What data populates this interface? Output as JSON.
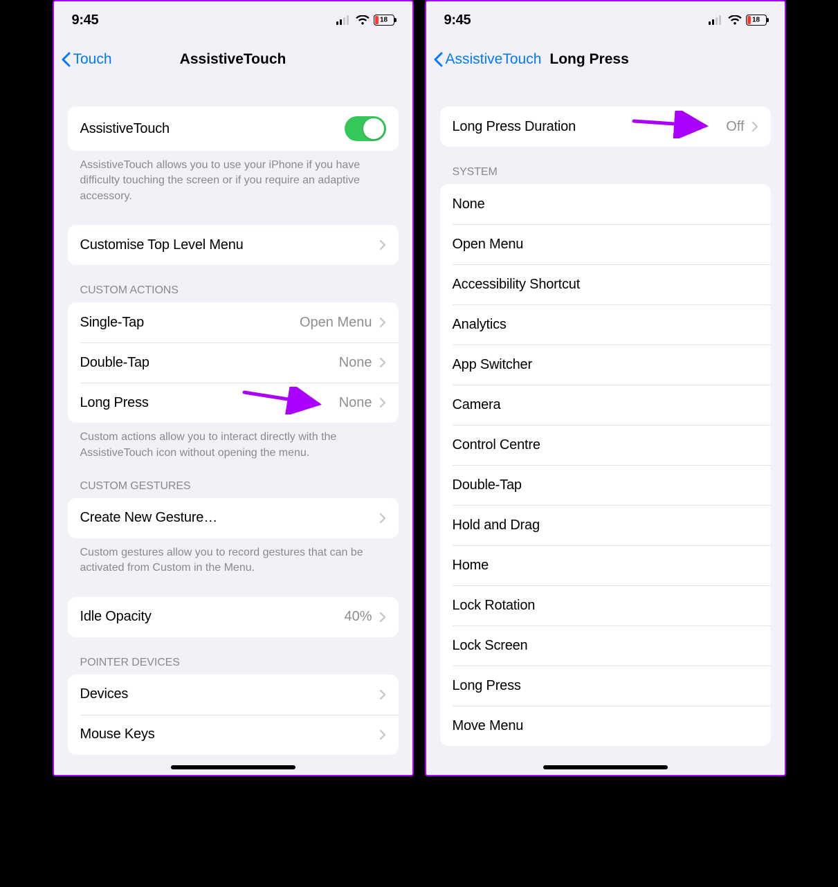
{
  "statusBar": {
    "time": "9:45",
    "batteryPercent": "18"
  },
  "left": {
    "back": "Touch",
    "title": "AssistiveTouch",
    "toggle": {
      "label": "AssistiveTouch"
    },
    "toggleFooter": "AssistiveTouch allows you to use your iPhone if you have difficulty touching the screen or if you require an adaptive accessory.",
    "customise": {
      "label": "Customise Top Level Menu"
    },
    "customActionsHeader": "CUSTOM ACTIONS",
    "customActions": [
      {
        "label": "Single-Tap",
        "value": "Open Menu"
      },
      {
        "label": "Double-Tap",
        "value": "None"
      },
      {
        "label": "Long Press",
        "value": "None"
      }
    ],
    "customActionsFooter": "Custom actions allow you to interact directly with the AssistiveTouch icon without opening the menu.",
    "customGesturesHeader": "CUSTOM GESTURES",
    "createGesture": {
      "label": "Create New Gesture…"
    },
    "customGesturesFooter": "Custom gestures allow you to record gestures that can be activated from Custom in the Menu.",
    "idleOpacity": {
      "label": "Idle Opacity",
      "value": "40%"
    },
    "pointerDevicesHeader": "POINTER DEVICES",
    "pointerDevices": [
      {
        "label": "Devices"
      },
      {
        "label": "Mouse Keys"
      }
    ]
  },
  "right": {
    "back": "AssistiveTouch",
    "title": "Long Press",
    "duration": {
      "label": "Long Press Duration",
      "value": "Off"
    },
    "systemHeader": "SYSTEM",
    "systemItems": [
      "None",
      "Open Menu",
      "Accessibility Shortcut",
      "Analytics",
      "App Switcher",
      "Camera",
      "Control Centre",
      "Double-Tap",
      "Hold and Drag",
      "Home",
      "Lock Rotation",
      "Lock Screen",
      "Long Press",
      "Move Menu"
    ]
  }
}
